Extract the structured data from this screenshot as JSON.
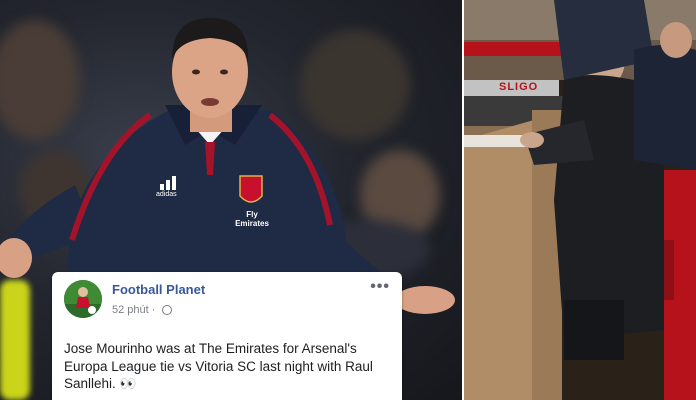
{
  "post": {
    "page_name": "Football Planet",
    "time": "52 phút",
    "separator": "·",
    "more_menu": "•••",
    "text": "Jose Mourinho was at The Emirates for Arsenal's Europa League tie vs Vitoria SC last night with Raul Sanllehi. 👀"
  },
  "photo_left": {
    "crest_text": "Fly Emirates",
    "brand": "adidas"
  },
  "photo_right": {
    "board_text": "SLIGO"
  },
  "colors": {
    "jacket": "#1f2a44",
    "jacket_trim": "#a3142b",
    "link_blue": "#385898",
    "seat_red": "#b5121b"
  }
}
